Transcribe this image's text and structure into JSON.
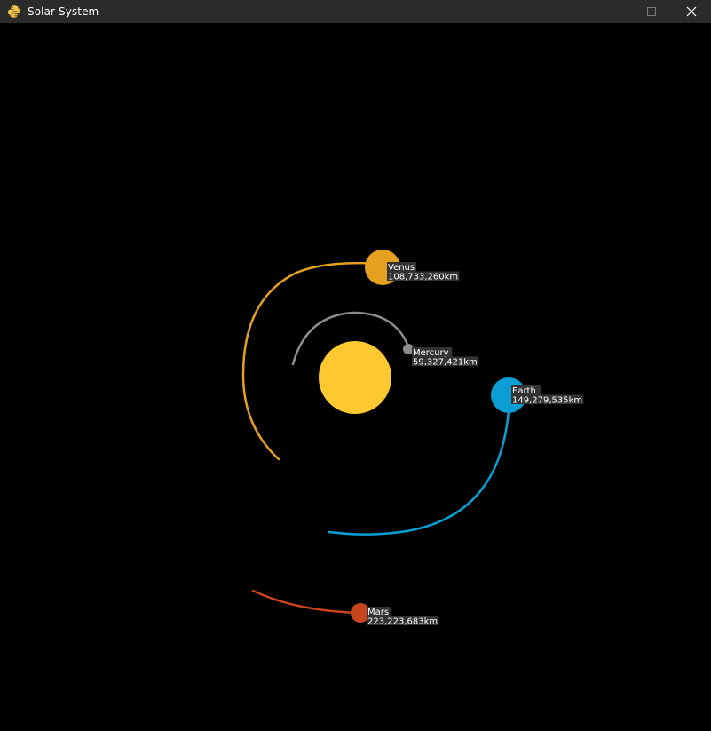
{
  "window": {
    "title": "Solar System",
    "app_icon": "python-icon",
    "controls": [
      "minimize-icon",
      "maximize-icon",
      "close-icon"
    ]
  },
  "colors": {
    "background": "#000000",
    "titlebar": "#2b2b2b",
    "sun": "#fdc830",
    "mercury": "#8c8c8c",
    "venus": "#e6a020",
    "earth": "#0a9ed4",
    "mars": "#c7441c",
    "label_bg": "#333333",
    "label_text": "#ffffff"
  },
  "sun": {
    "name": "Sun"
  },
  "planets": [
    {
      "key": "mercury",
      "name": "Mercury",
      "distance": "59,327,421km"
    },
    {
      "key": "venus",
      "name": "Venus",
      "distance": "108,733,260km"
    },
    {
      "key": "earth",
      "name": "Earth",
      "distance": "149,279,535km"
    },
    {
      "key": "mars",
      "name": "Mars",
      "distance": "223,223,683km"
    }
  ]
}
